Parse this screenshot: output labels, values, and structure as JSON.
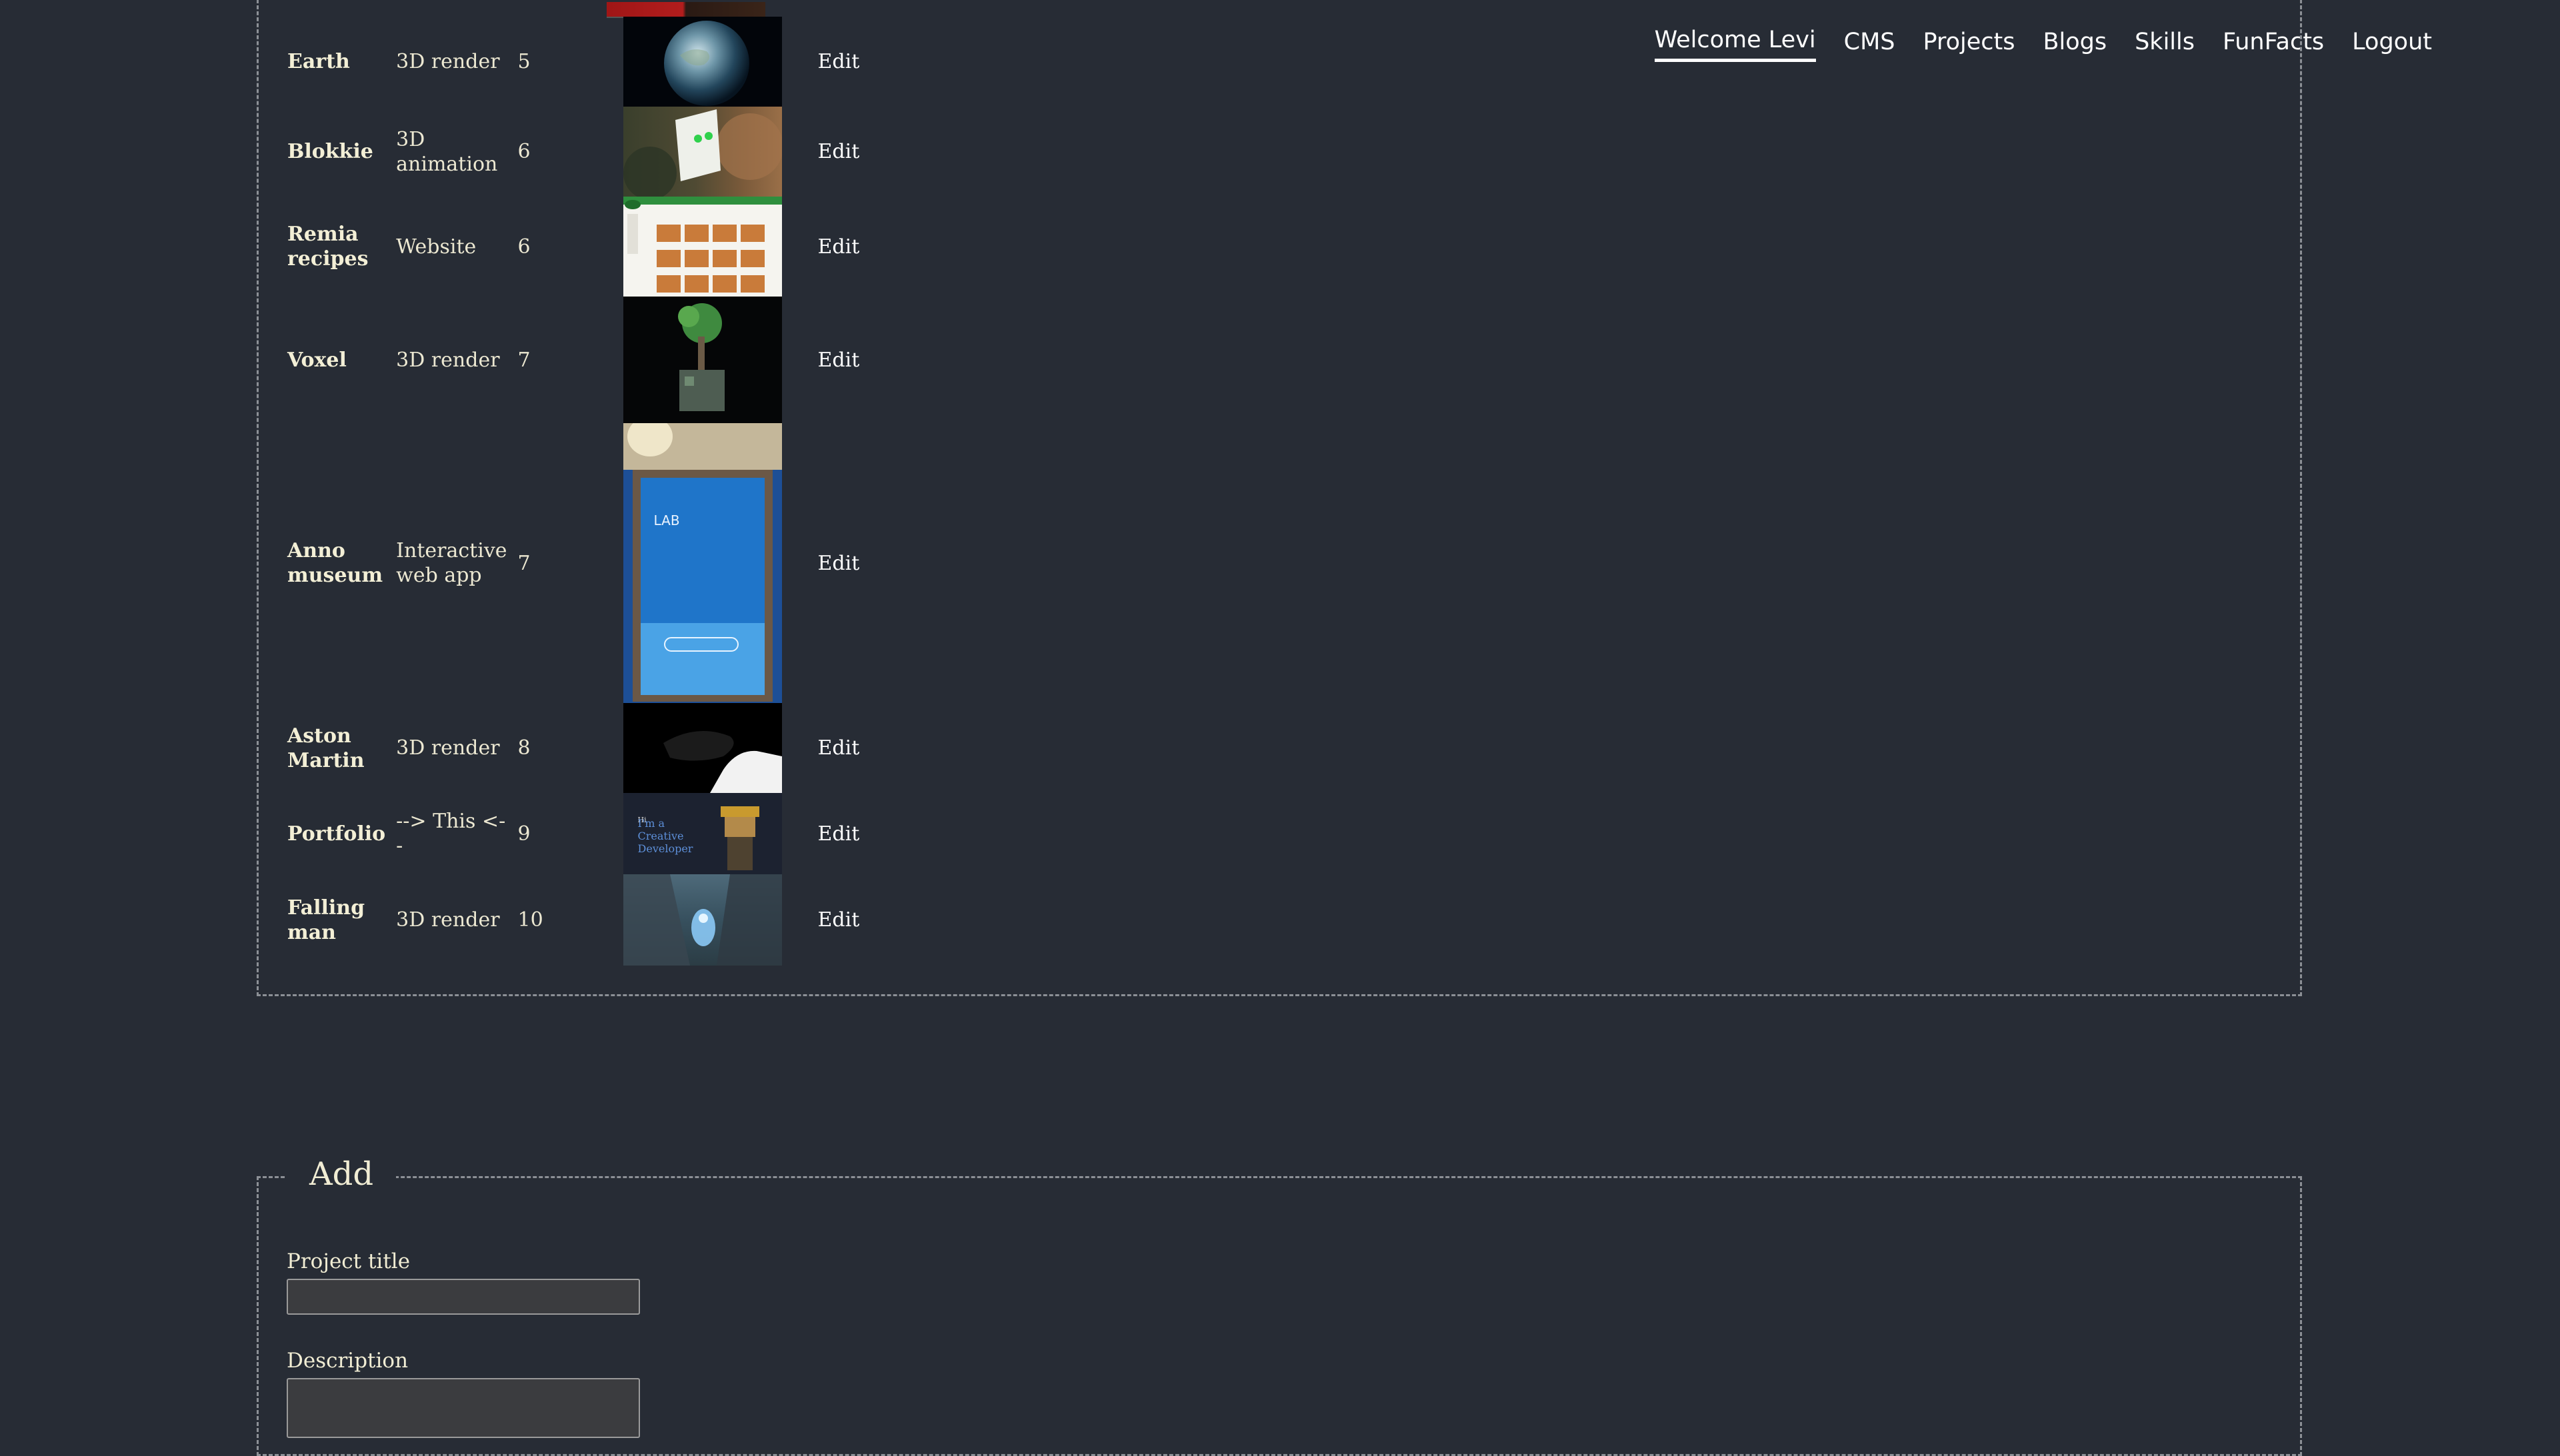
{
  "nav": {
    "items": [
      "Welcome Levi",
      "CMS",
      "Projects",
      "Blogs",
      "Skills",
      "FunFacts",
      "Logout"
    ]
  },
  "projects": [
    {
      "title": "Earth",
      "type": "3D render",
      "order": "5",
      "edit": "Edit"
    },
    {
      "title": "Blokkie",
      "type": "3D animation",
      "order": "6",
      "edit": "Edit"
    },
    {
      "title": "Remia recipes",
      "type": "Website",
      "order": "6",
      "edit": "Edit"
    },
    {
      "title": "Voxel",
      "type": "3D render",
      "order": "7",
      "edit": "Edit"
    },
    {
      "title": "Anno museum",
      "type": "Interactive web app",
      "order": "7",
      "edit": "Edit"
    },
    {
      "title": "Aston Martin",
      "type": "3D render",
      "order": "8",
      "edit": "Edit"
    },
    {
      "title": "Portfolio",
      "type": "--> This <--",
      "order": "9",
      "edit": "Edit"
    },
    {
      "title": "Falling man",
      "type": "3D render",
      "order": "10",
      "edit": "Edit"
    }
  ],
  "thumbnails": {
    "lab_text": "LAB",
    "portfolio_hi": "Hi",
    "portfolio_text": "I'm a Creative Developer"
  },
  "add_form": {
    "legend": "Add",
    "project_title_label": "Project title",
    "project_title_value": "",
    "description_label": "Description",
    "description_value": ""
  }
}
